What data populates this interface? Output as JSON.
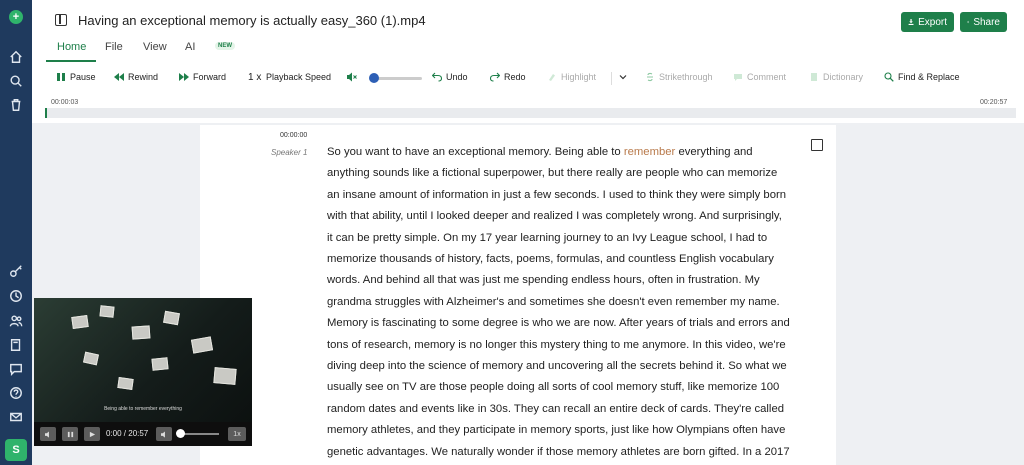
{
  "app": {
    "avatar_initial": "S"
  },
  "rail": {
    "icons": [
      "logo-icon",
      "home-icon",
      "search-icon",
      "trash-icon",
      "key-icon",
      "clock-icon",
      "users-icon",
      "book-icon",
      "chat-icon",
      "help-icon",
      "mail-icon"
    ]
  },
  "header": {
    "file_title": "Having an exceptional memory is actually easy_360 (1).mp4",
    "export_label": "Export",
    "share_label": "Share"
  },
  "tabs": [
    {
      "label": "Home",
      "active": true
    },
    {
      "label": "File",
      "active": false
    },
    {
      "label": "View",
      "active": false
    },
    {
      "label": "AI",
      "active": false
    }
  ],
  "ai_badge": "NEW",
  "toolbar": {
    "pause": "Pause",
    "rewind": "Rewind",
    "forward": "Forward",
    "speed_value": "1 x",
    "speed_label": "Playback Speed",
    "undo": "Undo",
    "redo": "Redo",
    "highlight": "Highlight",
    "strikethrough": "Strikethrough",
    "comment": "Comment",
    "dictionary": "Dictionary",
    "find_replace": "Find & Replace"
  },
  "timeline": {
    "start": "00:00:03",
    "end": "00:20:57",
    "progress": 0.002
  },
  "transcript": {
    "timestamp": "00:00:00",
    "speaker": "Speaker 1",
    "lines": [
      [
        "So you want to have an exceptional memory. Being able to ",
        "remember",
        " everything and"
      ],
      [
        "anything sounds like a fictional superpower, but there really are people who can memorize"
      ],
      [
        "an insane amount of information in just a few seconds. I used to think they were simply born"
      ],
      [
        "with that ability, until I looked deeper and realized I was completely wrong. And surprisingly,"
      ],
      [
        "it can be pretty simple. On my 17 year learning journey to an Ivy League school, I had to"
      ],
      [
        "memorize thousands of history, facts, poems, formulas, and countless English vocabulary"
      ],
      [
        "words. And behind all that was just me spending endless hours, often in frustration. My"
      ],
      [
        "grandma struggles with Alzheimer's and sometimes she doesn't even remember my name."
      ],
      [
        "Memory is fascinating to some degree is who we are now. After years of trials and errors and"
      ],
      [
        "tons of research, memory is no longer this mystery thing to me anymore. In this video, we're"
      ],
      [
        "diving deep into the science of memory and uncovering all the secrets behind it. So what we"
      ],
      [
        "usually see on TV are those people doing all sorts of cool memory stuff, like memorize 100"
      ],
      [
        "random dates and events like in 30s. They can recall an entire deck of cards. They're called"
      ],
      [
        "memory athletes, and they participate in memory sports, just like how Olympians often have"
      ],
      [
        "genetic advantages. We naturally wonder if those memory athletes are born gifted. In a 2017"
      ]
    ]
  },
  "video": {
    "caption": "Being able to remember everything",
    "time": "0:00 / 20:57",
    "speed": "1x",
    "volume": 0.0
  }
}
